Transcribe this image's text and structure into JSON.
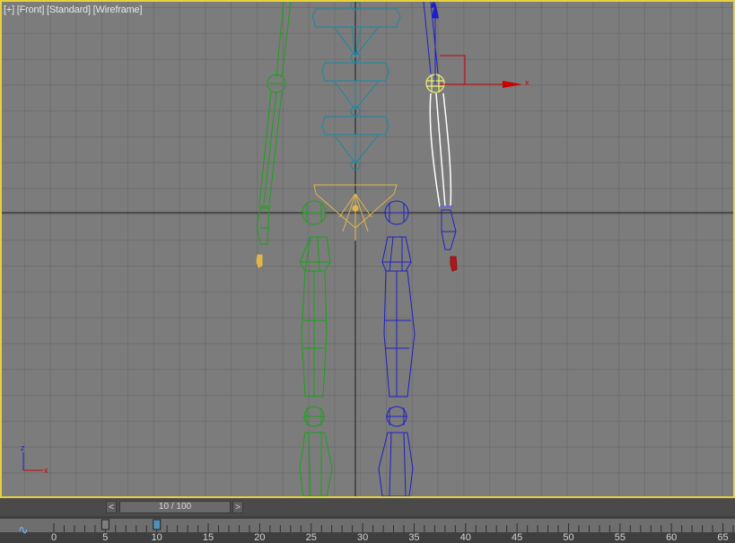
{
  "viewport": {
    "labels": [
      "[+]",
      "[Front]",
      "[Standard]",
      "[Wireframe]"
    ]
  },
  "gizmo": {
    "x_label": "x"
  },
  "axis_tripod": {
    "z_label": "z",
    "x_label": "x"
  },
  "timeline": {
    "prev_label": "<",
    "next_label": ">",
    "frame_display": "10 / 100",
    "current_frame": 10,
    "total_frames": 100,
    "ticks": [
      "0",
      "5",
      "10",
      "15",
      "20",
      "25",
      "30",
      "35",
      "40",
      "45",
      "50",
      "55",
      "60",
      "65"
    ],
    "key_frames": [
      5,
      10
    ]
  },
  "colors": {
    "viewport_bg": "#7c7c7c",
    "active_border": "#e8d23a",
    "left_bones": "#19a319",
    "right_bones": "#1f1fc8",
    "spine": "#1d87a3",
    "pelvis": "#e0b64a",
    "selected": "#ffffff",
    "gizmo_x": "#cc0000"
  },
  "icons": [
    "curve-editor-icon"
  ]
}
